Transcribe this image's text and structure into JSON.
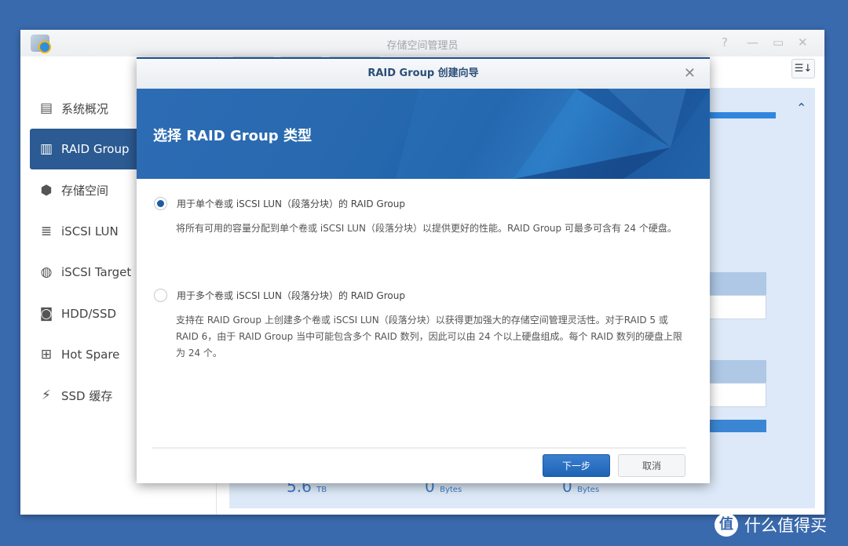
{
  "window": {
    "title": "存储空间管理员",
    "controls": {
      "help": "?",
      "minimize": "—",
      "maximize": "▭",
      "close": "✕"
    }
  },
  "sidebar": {
    "items": [
      {
        "label": "系统概况",
        "icon": "overview-icon",
        "glyph": "▤",
        "selected": false
      },
      {
        "label": "RAID Group",
        "icon": "raid-icon",
        "glyph": "▥",
        "selected": true
      },
      {
        "label": "存储空间",
        "icon": "cubes-icon",
        "glyph": "⬢",
        "selected": false
      },
      {
        "label": "iSCSI LUN",
        "icon": "database-icon",
        "glyph": "≣",
        "selected": false
      },
      {
        "label": "iSCSI Target",
        "icon": "globe-icon",
        "glyph": "◍",
        "selected": false
      },
      {
        "label": "HDD/SSD",
        "icon": "hdd-icon",
        "glyph": "◙",
        "selected": false
      },
      {
        "label": "Hot Spare",
        "icon": "plus-box-icon",
        "glyph": "⊞",
        "selected": false
      },
      {
        "label": "SSD 缓存",
        "icon": "ssd-icon",
        "glyph": "⚡",
        "selected": false
      }
    ]
  },
  "main": {
    "sort_glyph": "☰↓",
    "values": [
      {
        "num": "5.6",
        "unit": "TB"
      },
      {
        "num": "0",
        "unit": "Bytes"
      },
      {
        "num": "0",
        "unit": "Bytes"
      }
    ]
  },
  "dialog": {
    "title": "RAID Group 创建向导",
    "close": "✕",
    "heading": "选择 RAID Group 类型",
    "options": [
      {
        "label": "用于单个卷或 iSCSI LUN（段落分块）的 RAID Group",
        "selected": true,
        "desc": "将所有可用的容量分配到单个卷或 iSCSI LUN（段落分块）以提供更好的性能。RAID Group 可最多可含有 24 个硬盘。"
      },
      {
        "label": "用于多个卷或 iSCSI LUN（段落分块）的 RAID Group",
        "selected": false,
        "desc": "支持在 RAID Group 上创建多个卷或 iSCSI LUN（段落分块）以获得更加强大的存储空间管理灵活性。对于RAID 5 或 RAID 6，由于 RAID Group 当中可能包含多个 RAID 数列，因此可以由 24 个以上硬盘组成。每个 RAID 数列的硬盘上限为 24 个。"
      }
    ],
    "next_label": "下一步",
    "cancel_label": "取消"
  },
  "watermark": {
    "logo": "值",
    "text": "什么值得买"
  },
  "colors": {
    "desktop": "#3a6aae",
    "accent": "#2c5a92",
    "banner": "#2668ae",
    "primary_button": "#1f63b5"
  }
}
